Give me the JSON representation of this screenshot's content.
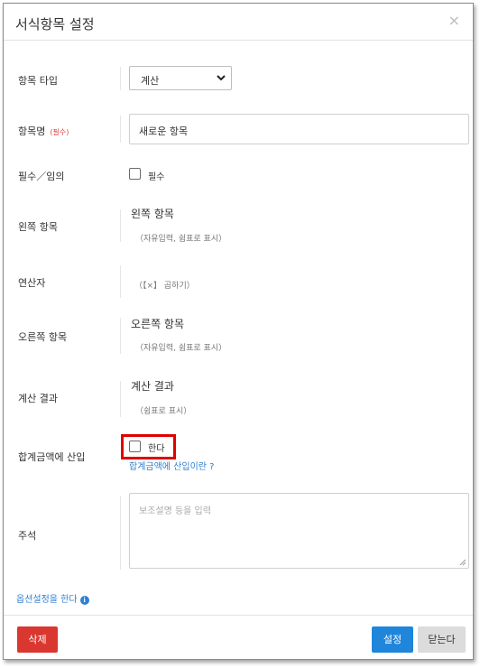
{
  "dialog": {
    "title": "서식항목 설정",
    "close_glyph": "×"
  },
  "fields": {
    "item_type": {
      "label": "항목 타입",
      "value": "계산"
    },
    "item_name": {
      "label": "항목명",
      "required_mark": "(필수)",
      "value": "새로운 항목"
    },
    "required": {
      "label": "필수／임의",
      "checkbox_label": "필수",
      "checked": false
    },
    "left_item": {
      "label": "왼쪽 항목",
      "value": "왼쪽 항목",
      "hint": "（자유입력, 쉼표로 표시）"
    },
    "operator": {
      "label": "연산자",
      "value": "（【×】 곱하기）"
    },
    "right_item": {
      "label": "오른쪽 항목",
      "value": "오른쪽 항목",
      "hint": "（자유입력, 쉼표로 표시）"
    },
    "calc_result": {
      "label": "계산 결과",
      "value": "계산 결과",
      "hint": "（쉼표로 표시）"
    },
    "sum_insert": {
      "label": "합계금액에 산입",
      "checkbox_label": "한다",
      "checked": false,
      "help_link": "합계금액에 산입이란 ?"
    },
    "note": {
      "label": "주석",
      "placeholder": "보조설명 등을 입력"
    }
  },
  "options_link": "옵션설정을 한다",
  "buttons": {
    "delete": "삭제",
    "set": "설정",
    "close": "닫는다"
  },
  "colors": {
    "delete": "#d9372f",
    "primary": "#1f86db",
    "link": "#2f7fd1",
    "highlight": "#e00000"
  }
}
